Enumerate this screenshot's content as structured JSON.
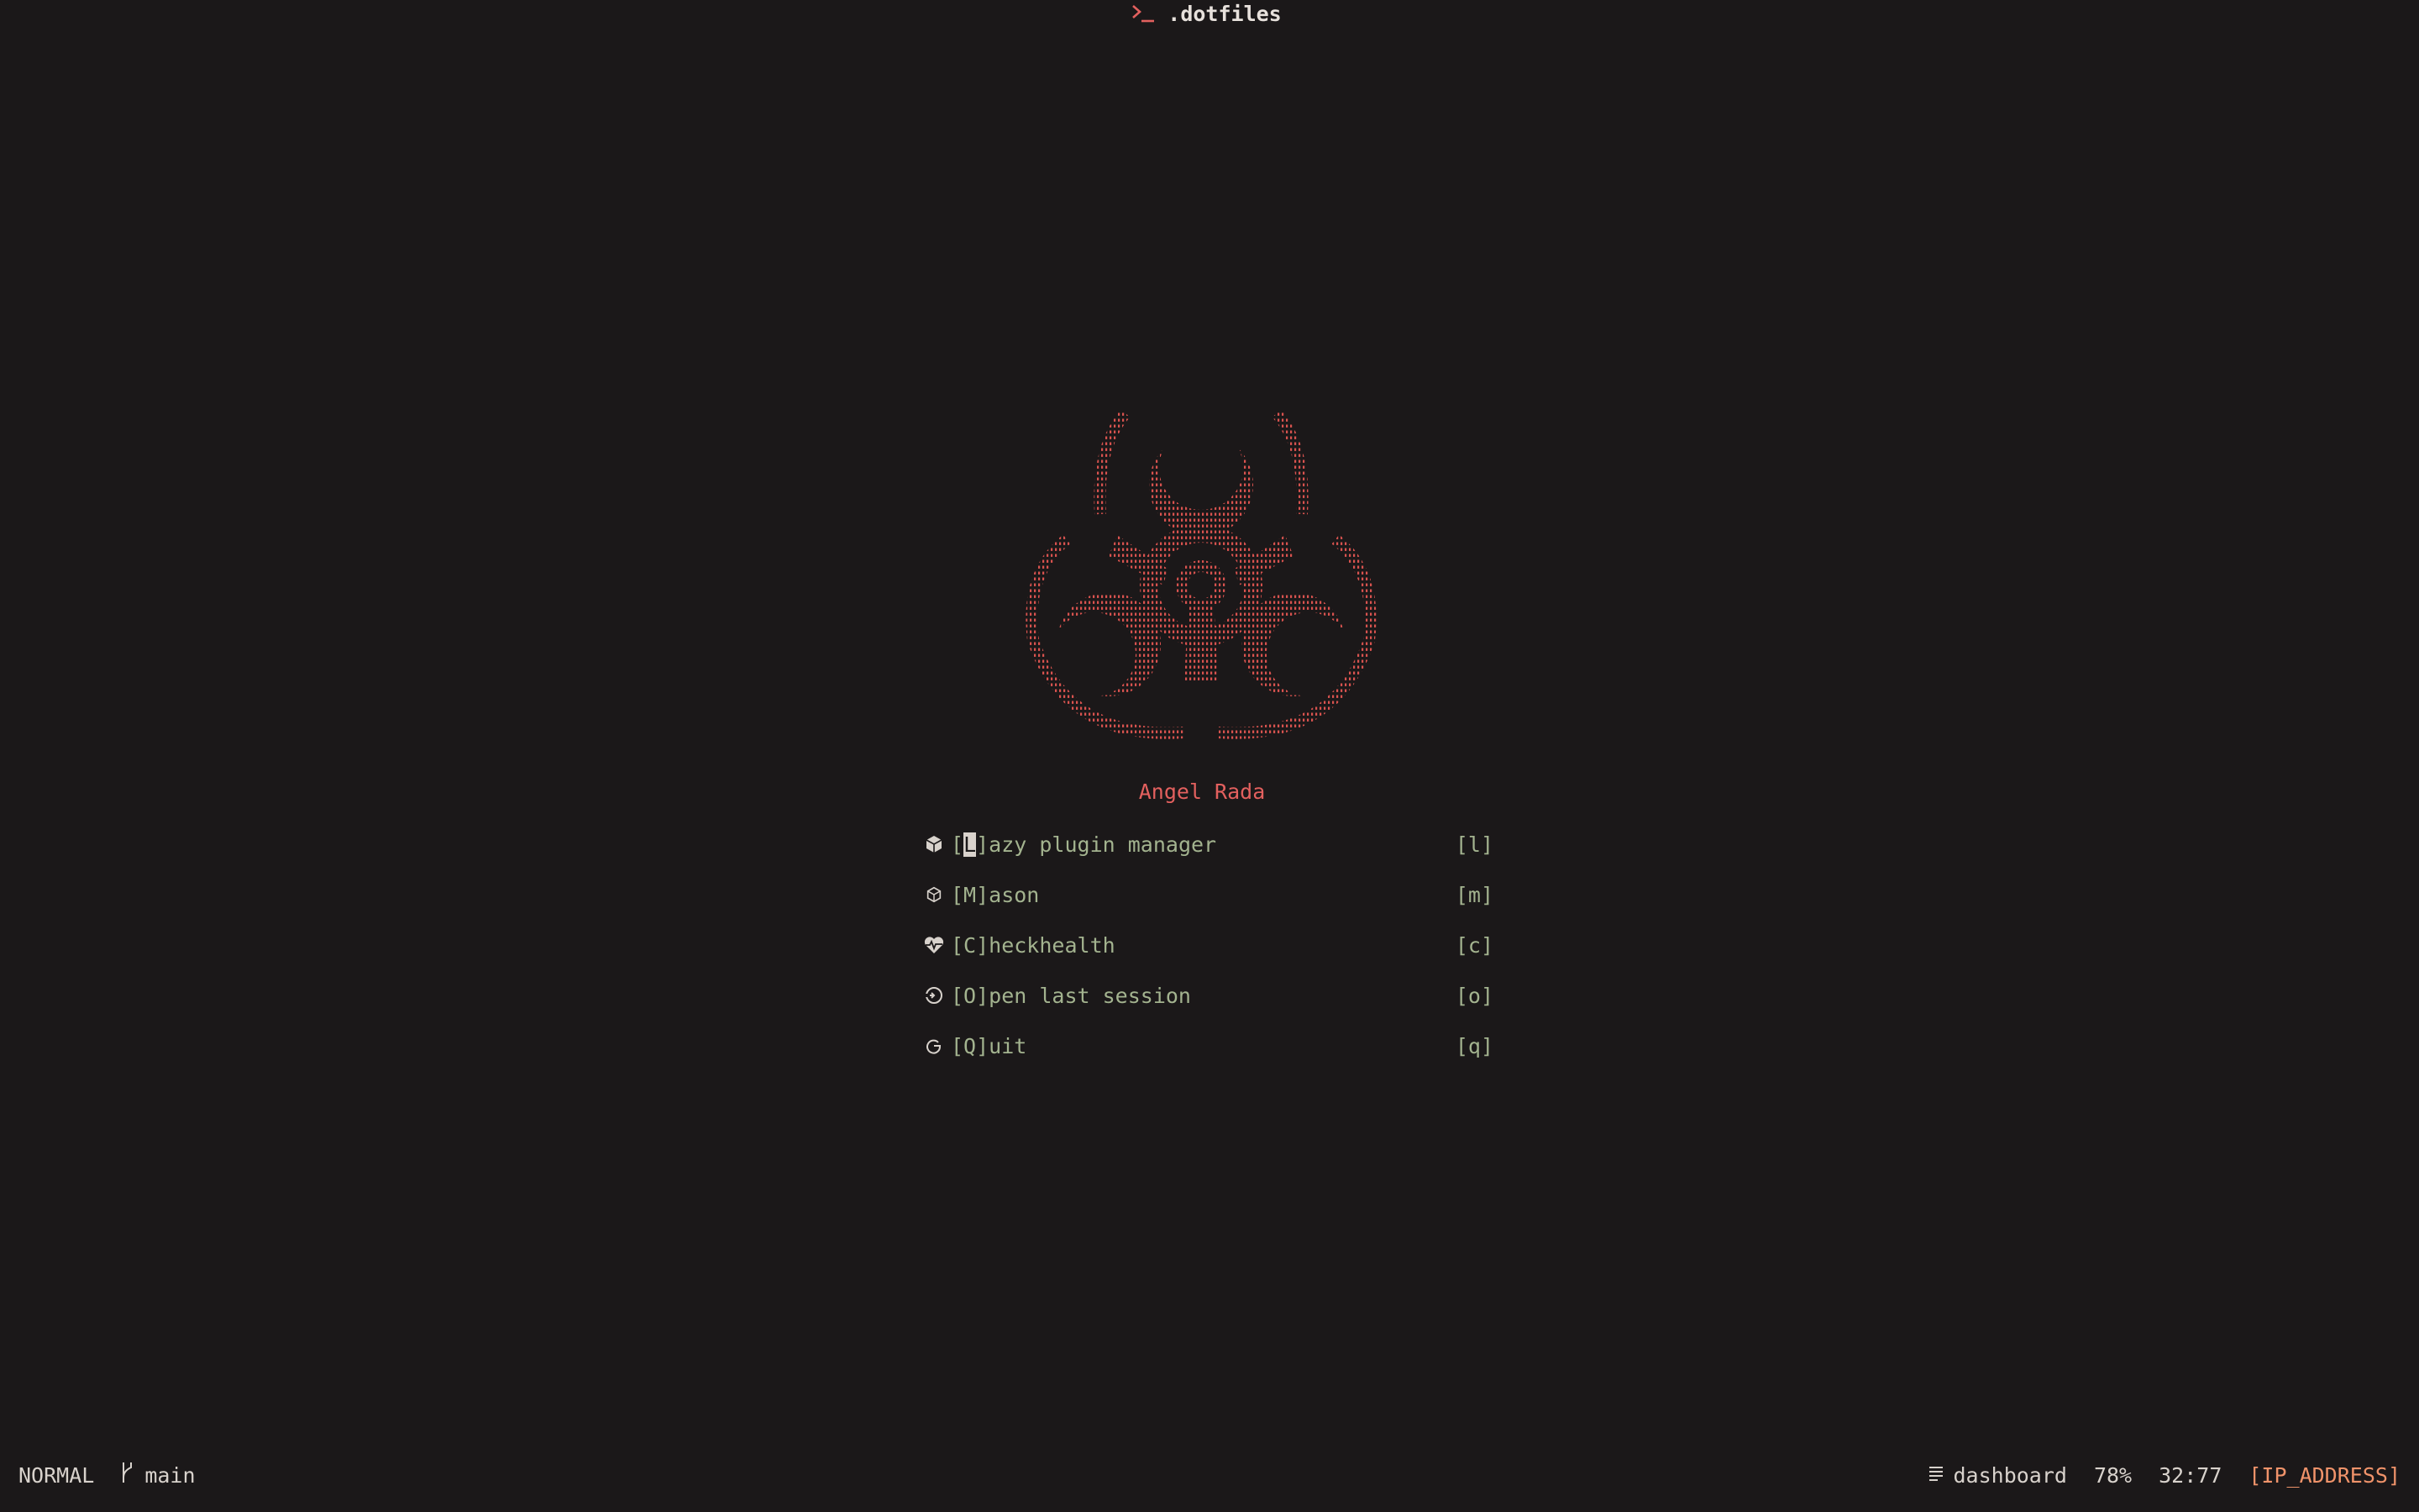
{
  "window": {
    "title": ".dotfiles",
    "title_icon": "terminal-prompt-icon"
  },
  "dashboard": {
    "author": "Angel Rada",
    "logo": "biohazard-ascii-art",
    "logo_color": "#e3605e",
    "menu": [
      {
        "icon": "package-icon",
        "label_prefix": "[",
        "cursor_char": "L",
        "label_rest": "]azy plugin manager",
        "key": "[l]"
      },
      {
        "icon": "box-icon",
        "label_prefix": "",
        "cursor_char": "",
        "label_rest": "[M]ason",
        "key": "[m]"
      },
      {
        "icon": "heart-pulse-icon",
        "label_prefix": "",
        "cursor_char": "",
        "label_rest": "[C]heckhealth",
        "key": "[c]"
      },
      {
        "icon": "restore-session-icon",
        "label_prefix": "",
        "cursor_char": "",
        "label_rest": "[O]pen last session",
        "key": "[o]"
      },
      {
        "icon": "power-icon",
        "label_prefix": "",
        "cursor_char": "",
        "label_rest": "[Q]uit",
        "key": "[q]"
      }
    ]
  },
  "statusline": {
    "mode": "NORMAL",
    "branch": "main",
    "branch_icon": "git-branch-icon",
    "filetype": "dashboard",
    "filetype_icon": "lines-icon",
    "progress": "78%",
    "position": "32:77",
    "ip": "[IP_ADDRESS]"
  },
  "colors": {
    "background": "#1b1819",
    "accent_red": "#e3605e",
    "menu_green": "#a3b38f",
    "ip_orange": "#f0936a"
  }
}
